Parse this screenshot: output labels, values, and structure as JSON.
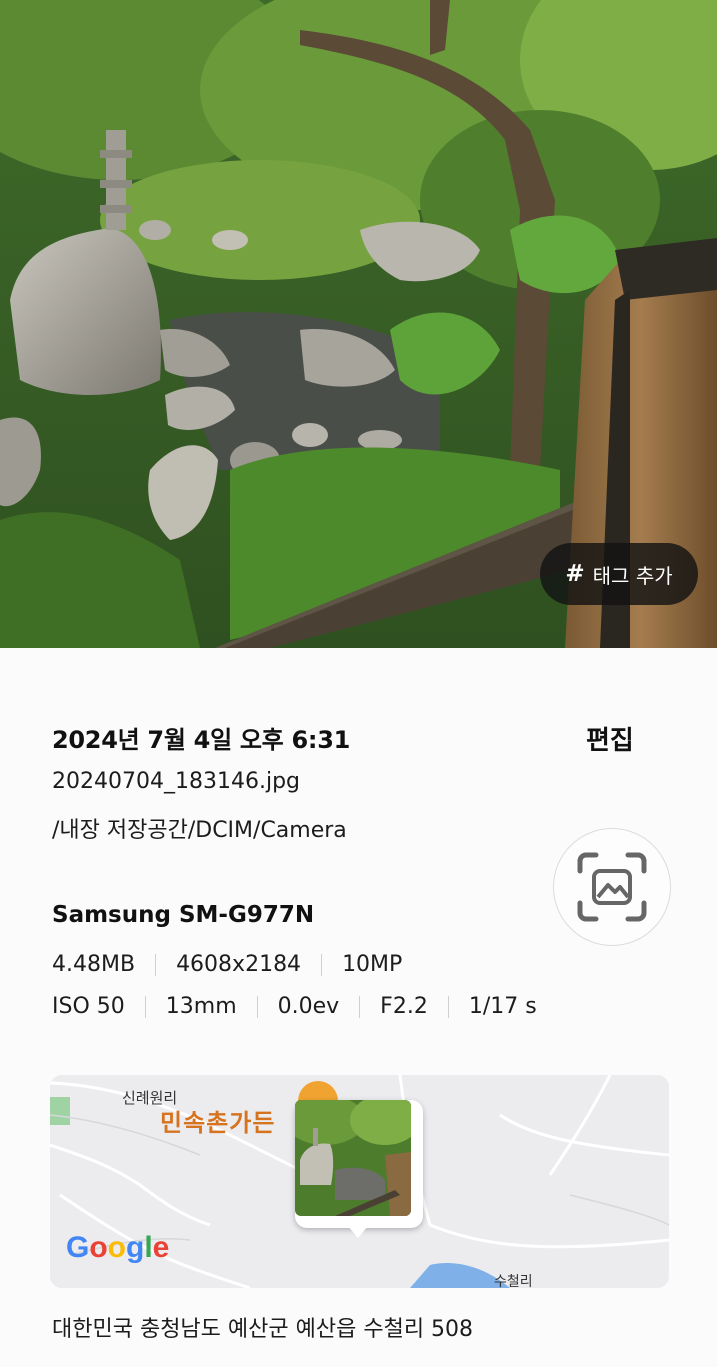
{
  "photo": {
    "tag_button_label": "태그 추가",
    "tag_button_icon": "hash-icon"
  },
  "details": {
    "date": "2024년 7월 4일 오후 6:31",
    "edit_label": "편집",
    "filename": "20240704_183146.jpg",
    "path": "/내장 저장공간/DCIM/Camera",
    "lens_button_icon": "image-scan-icon",
    "device": "Samsung SM-G977N",
    "file_specs": [
      "4.48MB",
      "4608x2184",
      "10MP"
    ],
    "camera_specs": [
      "ISO 50",
      "13mm",
      "0.0ev",
      "F2.2",
      "1/17 s"
    ]
  },
  "map": {
    "village_label": "신례원리",
    "poi_label": "민속촌가든",
    "area_label": "수철리",
    "provider_logo": "Google"
  },
  "address": "대한민국 충청남도 예산군 예산읍 수철리 508",
  "colors": {
    "background": "#fbfbfb",
    "tag_pill": "#141414",
    "poi_text": "#d6731f"
  }
}
